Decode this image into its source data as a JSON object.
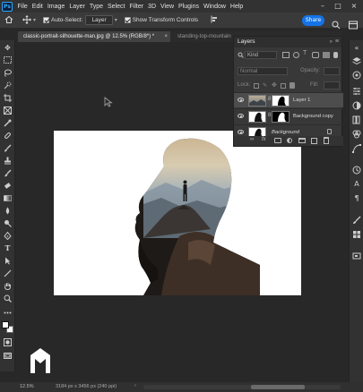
{
  "app": {
    "logo_text": "Ps"
  },
  "menu": [
    "File",
    "Edit",
    "Image",
    "Layer",
    "Type",
    "Select",
    "Filter",
    "3D",
    "View",
    "Plugins",
    "Window",
    "Help"
  ],
  "window_controls": {
    "minimize": "–",
    "maximize": "□",
    "close": "×"
  },
  "options_bar": {
    "auto_select_label": "Auto-Select:",
    "auto_select_value": "Layer",
    "show_transform_label": "Show Transform Controls",
    "share_label": "Share"
  },
  "tabs": [
    {
      "label": "classic-portrait-silhouette-man.jpg @ 12.5% (RGB/8*) *",
      "close": "×"
    },
    {
      "label": "standing-top-mountain"
    }
  ],
  "layers_panel": {
    "title": "Layers",
    "kind_label": "Kind",
    "blend_mode": "Normal",
    "opacity_label": "Opacity:",
    "lock_label": "Lock:",
    "fill_label": "Fill:",
    "layers": [
      {
        "name": "Layer 1",
        "selected": true
      },
      {
        "name": "Background copy",
        "selected": false
      },
      {
        "name": "Background",
        "selected": false
      }
    ]
  },
  "status": {
    "zoom": "12.5%",
    "doc_info": "3184 px x 3456 px (240 ppi)"
  },
  "colors": {
    "accent": "#1473e6",
    "panel": "#383838",
    "canvas": "#282828"
  }
}
